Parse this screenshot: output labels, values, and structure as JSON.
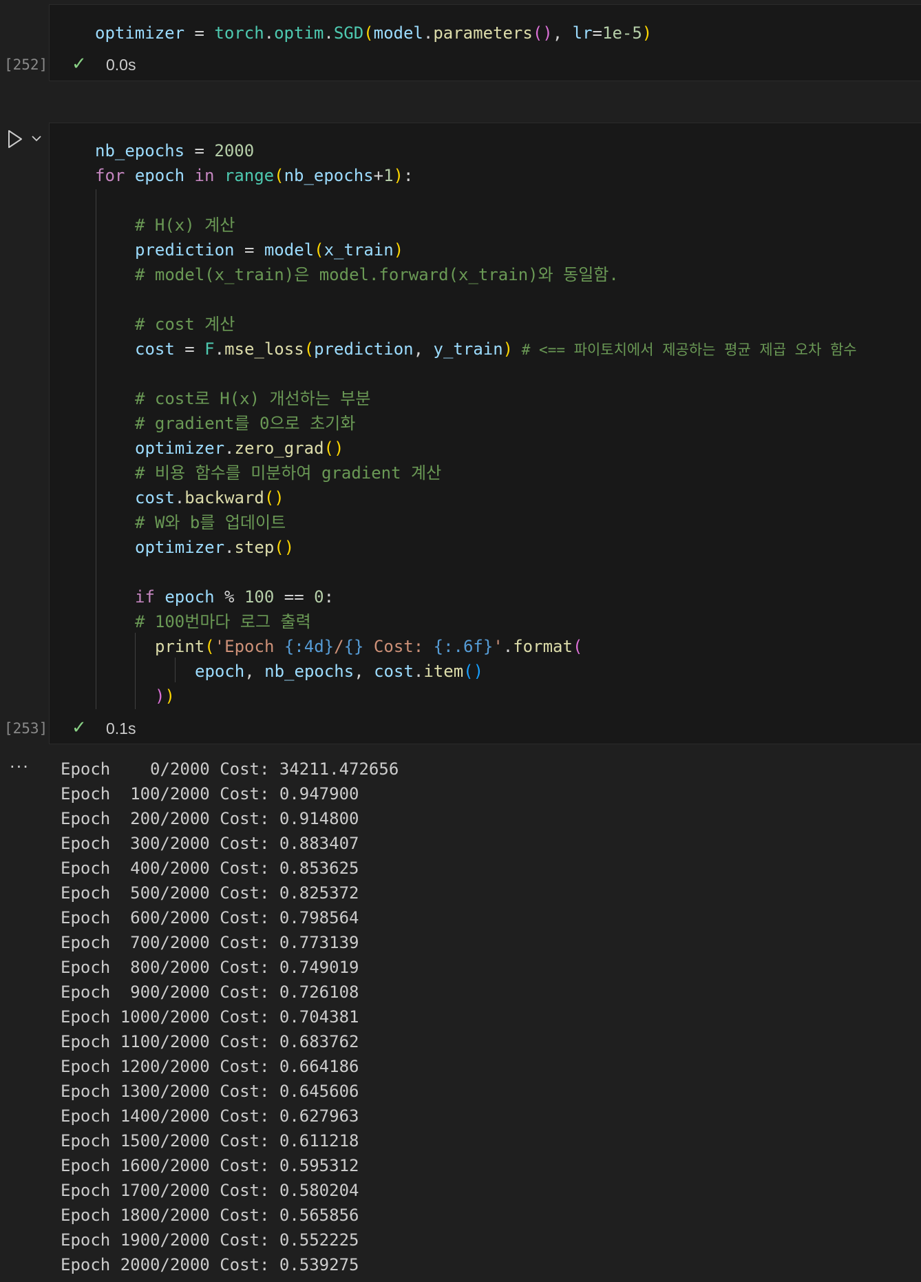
{
  "cell1": {
    "execution_count": "[252]",
    "code": {
      "line1": {
        "t1": "optimizer",
        "t2": " = ",
        "t3": "torch",
        "t4": ".",
        "t5": "optim",
        "t6": ".",
        "t7": "SGD",
        "t8": "(",
        "t9": "model",
        "t10": ".",
        "t11": "parameters",
        "t12": "()",
        "t13": ", ",
        "t14": "lr",
        "t15": "=",
        "t16": "1e-5",
        "t17": ")"
      }
    },
    "status": {
      "check": "✓",
      "time": "0.0s"
    }
  },
  "cell2": {
    "execution_count": "[253]",
    "code": {
      "l1": {
        "a": "nb_epochs",
        "b": " = ",
        "c": "2000"
      },
      "l2": {
        "a": "for",
        "b": " ",
        "c": "epoch",
        "d": " in ",
        "e": "range",
        "f": "(",
        "g": "nb_epochs",
        "h": "+",
        "i": "1",
        "j": ")",
        "k": ":"
      },
      "l4": "# H(x) 계산",
      "l5": {
        "a": "prediction",
        "b": " = ",
        "c": "model",
        "d": "(",
        "e": "x_train",
        "f": ")"
      },
      "l6": "# model(x_train)은 model.forward(x_train)와 동일함.",
      "l8": "# cost 계산",
      "l9": {
        "a": "cost",
        "b": " = ",
        "c": "F",
        "d": ".",
        "e": "mse_loss",
        "f": "(",
        "g": "prediction",
        "h": ", ",
        "i": "y_train",
        "j": ")",
        "k": " # <== 파이토치에서 제공하는 평균 제곱 오차 함수"
      },
      "l11": "# cost로 H(x) 개선하는 부분",
      "l12": "# gradient를 0으로 초기화",
      "l13": {
        "a": "optimizer",
        "b": ".",
        "c": "zero_grad",
        "d": "()"
      },
      "l14": "# 비용 함수를 미분하여 gradient 계산",
      "l15": {
        "a": "cost",
        "b": ".",
        "c": "backward",
        "d": "()"
      },
      "l16": "# W와 b를 업데이트",
      "l17": {
        "a": "optimizer",
        "b": ".",
        "c": "step",
        "d": "()"
      },
      "l19": {
        "a": "if",
        "b": " ",
        "c": "epoch",
        "d": " % ",
        "e": "100",
        "f": " == ",
        "g": "0",
        "h": ":"
      },
      "l20": "# 100번마다 로그 출력",
      "l21": {
        "a": "print",
        "b": "(",
        "c": "'Epoch ",
        "d": "{:4d}",
        "e": "/",
        "f": "{}",
        "g": " Cost: ",
        "h": "{:.6f}",
        "i": "'",
        "j": ".",
        "k": "format",
        "l": "("
      },
      "l22": {
        "a": "epoch",
        "b": ", ",
        "c": "nb_epochs",
        "d": ", ",
        "e": "cost",
        "f": ".",
        "g": "item",
        "h": "()"
      },
      "l23": {
        "a": ")",
        "b": ")"
      }
    },
    "status": {
      "check": "✓",
      "time": "0.1s"
    }
  },
  "output": {
    "ellipsis": "···",
    "lines": [
      "Epoch    0/2000 Cost: 34211.472656",
      "Epoch  100/2000 Cost: 0.947900",
      "Epoch  200/2000 Cost: 0.914800",
      "Epoch  300/2000 Cost: 0.883407",
      "Epoch  400/2000 Cost: 0.853625",
      "Epoch  500/2000 Cost: 0.825372",
      "Epoch  600/2000 Cost: 0.798564",
      "Epoch  700/2000 Cost: 0.773139",
      "Epoch  800/2000 Cost: 0.749019",
      "Epoch  900/2000 Cost: 0.726108",
      "Epoch 1000/2000 Cost: 0.704381",
      "Epoch 1100/2000 Cost: 0.683762",
      "Epoch 1200/2000 Cost: 0.664186",
      "Epoch 1300/2000 Cost: 0.645606",
      "Epoch 1400/2000 Cost: 0.627963",
      "Epoch 1500/2000 Cost: 0.611218",
      "Epoch 1600/2000 Cost: 0.595312",
      "Epoch 1700/2000 Cost: 0.580204",
      "Epoch 1800/2000 Cost: 0.565856",
      "Epoch 1900/2000 Cost: 0.552225",
      "Epoch 2000/2000 Cost: 0.539275"
    ]
  },
  "icons": {
    "run": "run-cell-icon",
    "chevron": "chevron-down-icon",
    "check": "check-icon"
  },
  "colors": {
    "background": "#1f1f1f",
    "cell_background": "#181818",
    "check": "#89d185",
    "comment": "#6a9955",
    "keyword": "#c586c0",
    "variable": "#9cdcfe",
    "function": "#dcdcaa"
  }
}
